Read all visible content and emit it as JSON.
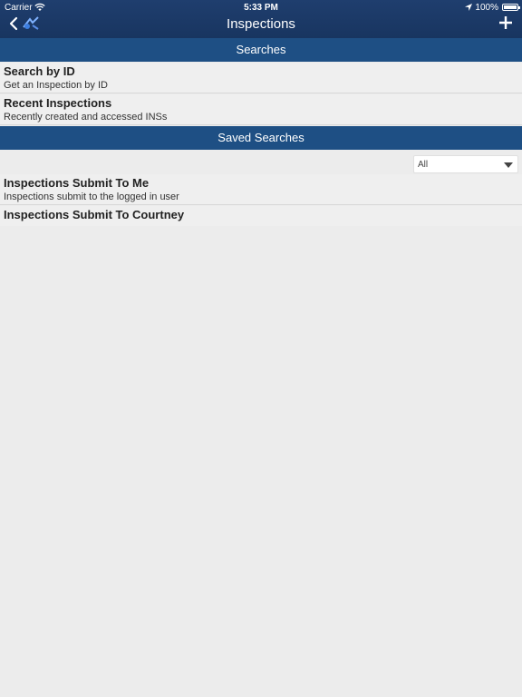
{
  "status_bar": {
    "carrier": "Carrier",
    "time": "5:33 PM",
    "battery": "100%"
  },
  "nav": {
    "title": "Inspections",
    "back_icon": "chevron-left-icon",
    "logo_icon": "app-logo-icon",
    "add_icon": "plus-icon"
  },
  "sections": {
    "searches": "Searches",
    "saved": "Saved Searches"
  },
  "searches": [
    {
      "title": "Search by ID",
      "subtitle": "Get an Inspection by ID"
    },
    {
      "title": "Recent Inspections",
      "subtitle": "Recently created and accessed INSs"
    }
  ],
  "filter": {
    "selected": "All"
  },
  "saved_searches": [
    {
      "title": "Inspections Submit To Me",
      "subtitle": "Inspections submit to the logged in user"
    },
    {
      "title": "Inspections Submit To Courtney",
      "subtitle": ""
    }
  ],
  "colors": {
    "nav_bg": "#1f3e6e",
    "section_bg": "#1e4f84",
    "page_bg": "#ececec"
  }
}
